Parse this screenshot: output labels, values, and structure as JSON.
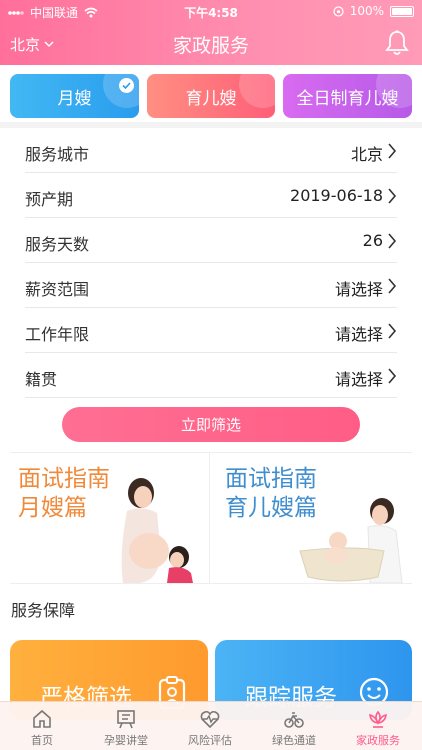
{
  "status_bar": {
    "carrier": "中国联通",
    "time": "下午4:58",
    "battery": "100%"
  },
  "header": {
    "city": "北京",
    "title": "家政服务"
  },
  "service_tabs": [
    {
      "label": "月嫂",
      "selected": true
    },
    {
      "label": "育儿嫂",
      "selected": false
    },
    {
      "label": "全日制育儿嫂",
      "selected": false
    }
  ],
  "form": {
    "rows": [
      {
        "label": "服务城市",
        "value": "北京"
      },
      {
        "label": "预产期",
        "value": "2019-06-18"
      },
      {
        "label": "服务天数",
        "value": "26"
      },
      {
        "label": "薪资范围",
        "value": "请选择"
      },
      {
        "label": "工作年限",
        "value": "请选择"
      },
      {
        "label": "籍贯",
        "value": "请选择"
      }
    ],
    "submit_label": "立即筛选"
  },
  "banners": [
    {
      "line1": "面试指南",
      "line2": "月嫂篇"
    },
    {
      "line1": "面试指南",
      "line2": "育儿嫂篇"
    }
  ],
  "guarantee": {
    "title": "服务保障",
    "cards": [
      {
        "label": "严格筛选",
        "icon": "clipboard-person-icon"
      },
      {
        "label": "跟踪服务",
        "icon": "smiley-icon"
      }
    ]
  },
  "tabbar": [
    {
      "label": "首页",
      "icon": "home-icon",
      "active": false
    },
    {
      "label": "孕婴讲堂",
      "icon": "lecture-board-icon",
      "active": false
    },
    {
      "label": "风险评估",
      "icon": "heartbeat-icon",
      "active": false
    },
    {
      "label": "绿色通道",
      "icon": "bicycle-icon",
      "active": false
    },
    {
      "label": "家政服务",
      "icon": "lotus-icon",
      "active": true
    }
  ],
  "colors": {
    "brand_pink": "#ff6f9a",
    "active_pink": "#ff5b8c",
    "tab_blue": "#2a9cee",
    "tab_red": "#ff5e78",
    "tab_purple": "#b65ae8"
  }
}
